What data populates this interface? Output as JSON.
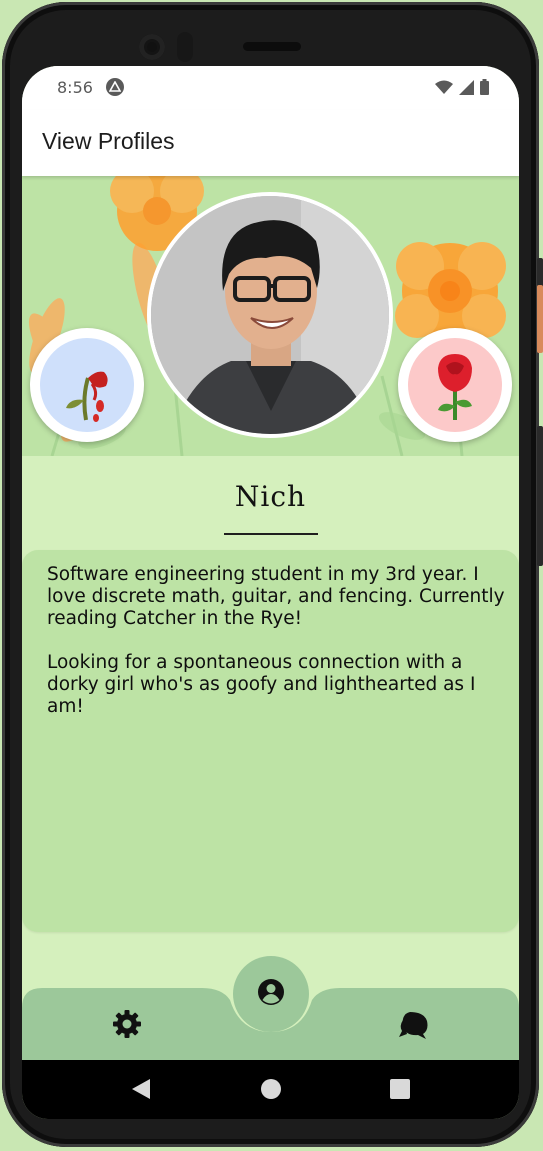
{
  "status_bar": {
    "time": "8:56",
    "icons": [
      "app-notification-icon",
      "wifi-icon",
      "cell-signal-icon",
      "battery-icon"
    ]
  },
  "app_bar": {
    "title": "View Profiles"
  },
  "profile": {
    "name": "Nich",
    "bio": "Software engineering student in my 3rd year. I love discrete math, guitar, and fencing. Currently reading Catcher in the Rye!\n\nLooking for a spontaneous connection with a dorky girl who's as goofy and lighthearted as I am!"
  },
  "actions": {
    "dislike_icon": "wilted-rose-icon",
    "like_icon": "rose-icon"
  },
  "bottom_nav": {
    "items": [
      "settings-icon",
      "profile-icon",
      "chat-icon"
    ],
    "active": "profile-icon"
  },
  "system_nav": [
    "back-icon",
    "home-icon",
    "recents-icon"
  ],
  "colors": {
    "screen_bg": "#d5f0bd",
    "card_bg": "#bde3a5",
    "nav_bg": "#9cc89a",
    "dislike_bg": "#cfe0fb",
    "like_bg": "#fcc9c9",
    "flower_orange": "#ffa02e"
  }
}
